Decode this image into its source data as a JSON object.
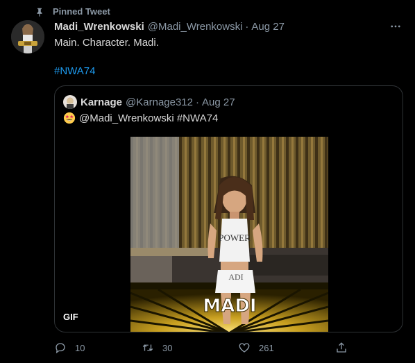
{
  "pinned": {
    "label": "Pinned Tweet"
  },
  "tweet": {
    "name": "Madi_Wrenkowski",
    "handle": "@Madi_Wrenkowski",
    "separator": "·",
    "date": "Aug 27",
    "text_line1": "Main. Character. Madi.",
    "hashtag": "#NWA74"
  },
  "quote": {
    "name": "Karnage",
    "handle": "@Karnage312",
    "separator": "·",
    "date": "Aug 27",
    "text": "@Madi_Wrenkowski #NWA74",
    "emoji": "star-struck-emoji",
    "media_caption": "MADI",
    "shirt_text_top": "POWER",
    "shirt_text_bottom": "ADI",
    "gif_badge": "GIF"
  },
  "actions": {
    "reply_count": "10",
    "retweet_count": "30",
    "like_count": "261"
  },
  "colors": {
    "background": "#000000",
    "text": "#d9d9d9",
    "secondary": "#8b98a5",
    "link": "#1d9bf0",
    "border": "#2f3336"
  }
}
